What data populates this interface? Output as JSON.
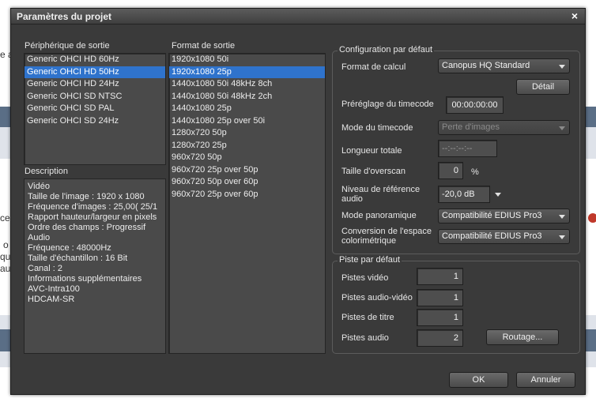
{
  "background_page": {
    "fragments": [
      "e a",
      "ce",
      "o",
      "qu",
      "au"
    ]
  },
  "dialog": {
    "title": "Paramètres du projet",
    "close_glyph": "×",
    "output_device": {
      "label": "Périphérique de sortie",
      "items": [
        "Generic OHCI HD 60Hz",
        "Generic OHCI HD 50Hz",
        "Generic OHCI HD 24Hz",
        "Generic OHCI SD NTSC",
        "Generic OHCI SD PAL",
        "Generic OHCI SD 24Hz"
      ],
      "selected_index": 1
    },
    "output_format": {
      "label": "Format de sortie",
      "items": [
        "1920x1080 50i",
        "1920x1080 25p",
        "1440x1080 50i 48kHz 8ch",
        "1440x1080 50i 48kHz 2ch",
        "1440x1080 25p",
        "1440x1080 25p over 50i",
        "1280x720 50p",
        "1280x720 25p",
        "960x720 50p",
        "960x720 25p over 50p",
        "960x720 50p over 60p",
        "960x720 25p over 60p"
      ],
      "selected_index": 1
    },
    "description": {
      "label": "Description",
      "lines": [
        "Vidéo",
        "Taille de l'image : 1920 x 1080",
        "Fréquence d'images : 25,00( 25/1",
        "Rapport hauteur/largeur en pixels",
        "Ordre des champs : Progressif",
        "Audio",
        "Fréquence : 48000Hz",
        "Taille d'échantillon : 16 Bit",
        "Canal : 2",
        "Informations supplémentaires",
        "AVC-Intra100",
        "HDCAM-SR"
      ]
    },
    "default_config": {
      "group_label": "Configuration par défaut",
      "calc_format_label": "Format de calcul",
      "calc_format_value": "Canopus HQ Standard",
      "detail_button": "Détail",
      "timecode_preset_label": "Préréglage du timecode",
      "timecode_preset_value": "00:00:00:00",
      "timecode_mode_label": "Mode du timecode",
      "timecode_mode_value": "Perte d'images",
      "total_length_label": "Longueur totale",
      "total_length_value": "--:--:--:--",
      "overscan_label": "Taille d'overscan",
      "overscan_value": "0",
      "overscan_unit": "%",
      "audio_ref_label": "Niveau de référence audio",
      "audio_ref_value": "-20,0 dB",
      "pan_mode_label": "Mode panoramique",
      "pan_mode_value": "Compatibilité EDIUS Pro3",
      "color_space_label": "Conversion de l'espace colorimétrique",
      "color_space_value": "Compatibilité EDIUS Pro3"
    },
    "default_tracks": {
      "group_label": "Piste par défaut",
      "video_tracks_label": "Pistes vidéo",
      "video_tracks_value": "1",
      "av_tracks_label": "Pistes audio-vidéo",
      "av_tracks_value": "1",
      "title_tracks_label": "Pistes de titre",
      "title_tracks_value": "1",
      "audio_tracks_label": "Pistes audio",
      "audio_tracks_value": "2",
      "routing_button": "Routage..."
    },
    "ok_button": "OK",
    "cancel_button": "Annuler"
  }
}
